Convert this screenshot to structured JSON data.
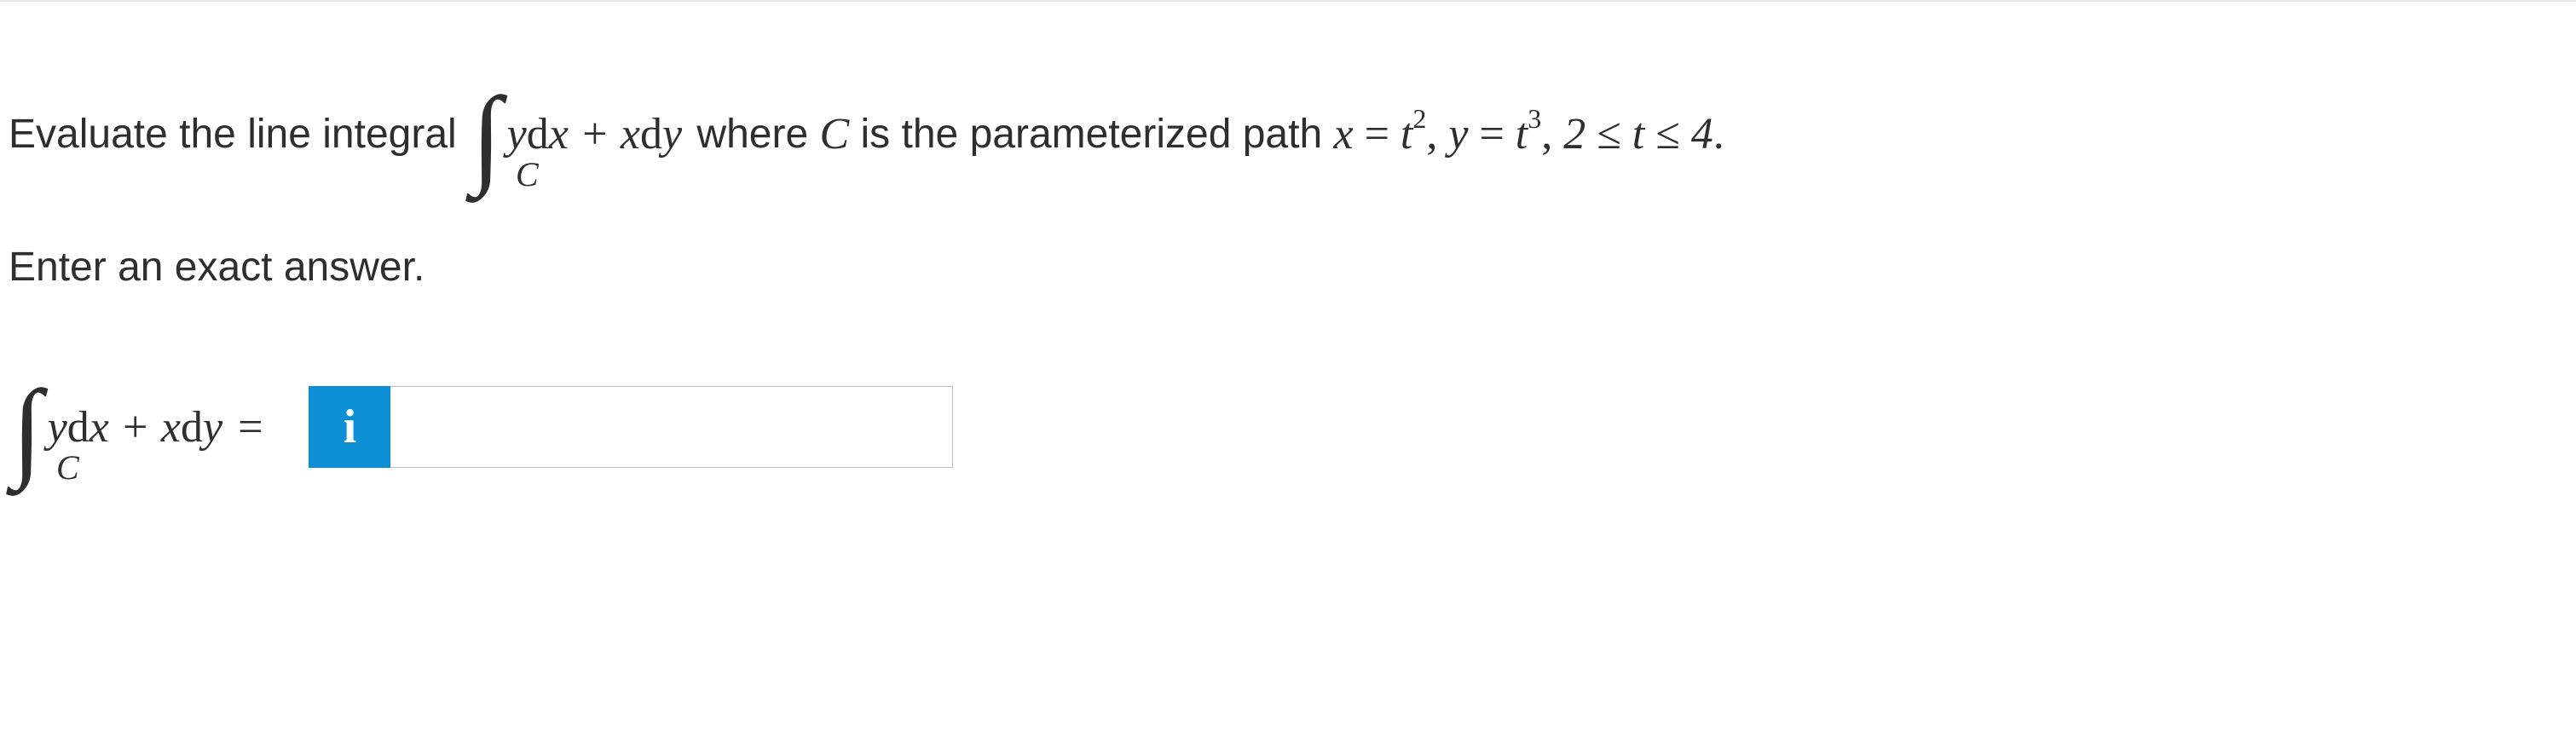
{
  "question": {
    "prefix_text": "Evaluate the line integral ",
    "integral": {
      "subscript": "C",
      "integrand_html": "y<span class=\"op\">d</span>x + x<span class=\"op\">d</span>y"
    },
    "mid_text_1": " where ",
    "var_C_html": "C",
    "mid_text_2": " is the parameterized path ",
    "param_html": "x <span class=\"op\">=</span> t<sup>2</sup><span class=\"op\">,</span> y <span class=\"op\">=</span> t<sup>3</sup><span class=\"op\">,</span> 2 <span class=\"op\">≤</span> t <span class=\"op\">≤</span> 4<span class=\"op\">.</span>"
  },
  "instruction": "Enter an exact answer.",
  "answer": {
    "integral": {
      "subscript": "C",
      "integrand_html": "y<span class=\"op\">d</span>x + x<span class=\"op\">d</span>y"
    },
    "equals": "=",
    "info_icon_label": "i",
    "input_value": "",
    "input_placeholder": ""
  }
}
